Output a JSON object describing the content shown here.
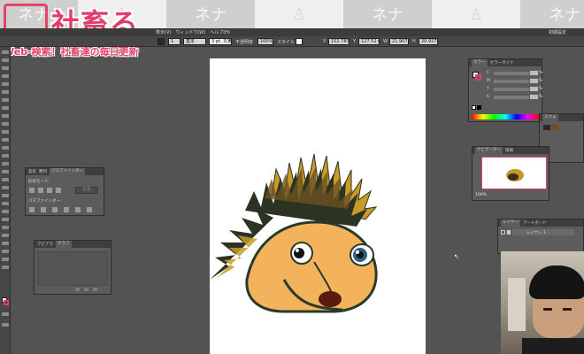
{
  "watermark": {
    "cells": [
      {
        "kind": "dark",
        "glyph": "ネナ"
      },
      {
        "kind": "light",
        "glyph": "♙"
      },
      {
        "kind": "dark",
        "glyph": "ネナ"
      },
      {
        "kind": "light",
        "glyph": "♙"
      },
      {
        "kind": "dark",
        "glyph": "ネナ"
      },
      {
        "kind": "light",
        "glyph": "♙"
      },
      {
        "kind": "dark",
        "glyph": "ネナ"
      }
    ]
  },
  "logo": {
    "title": "社畜る",
    "subtitle": "Web-検索！社畜達の毎日更新"
  },
  "menu": {
    "items": [
      "表示(V)",
      "ウィンドウ(W)",
      "ヘルプ(H)"
    ],
    "right_label": "初期設定"
  },
  "control_bar": {
    "stroke_weight": "1",
    "profile": "基本",
    "brush": "3 pt. 丸筆",
    "opacity_label": "不透明度",
    "opacity": "100%",
    "style_label": "スタイル",
    "x_label": "X",
    "x": "152.783 m",
    "y_label": "Y",
    "y": "127.52 mm",
    "w_label": "W",
    "w": "21.907 m",
    "h_label": "H",
    "h": "20.927 m"
  },
  "colors": {
    "accent": "#e23e6a",
    "ui_bg": "#535353",
    "panel": "#5c5c5c",
    "artboard": "#ffffff",
    "hedgehog_body": "#f2b35c",
    "hedgehog_quills": "#2c3322",
    "hedgehog_outline": "#2a3a2a",
    "hedgehog_nose": "#5a1a0c",
    "hedgehog_eye_iris": "#2e5f86"
  },
  "panels": {
    "color": {
      "tabs": [
        "カラー",
        "カラーガイド"
      ],
      "channels": [
        "C",
        "M",
        "Y",
        "K"
      ],
      "unit": "%"
    },
    "small": {
      "tabs": [
        "スウォ"
      ]
    },
    "navigator": {
      "tabs": [
        "ナビゲーター",
        "情報"
      ],
      "zoom": "100%"
    },
    "pathfinder": {
      "tabs": [
        "変形",
        "整列",
        "パスファインダー"
      ],
      "shape_mode_label": "形状モード：",
      "expand_label": "拡張",
      "pathfinder_label": "パスファインダー："
    },
    "appearance": {
      "tabs": [
        "アピアラ",
        "グラフ"
      ]
    },
    "layers": {
      "tabs": [
        "レイヤー",
        "アートボード"
      ],
      "layer_name": "レイヤー 1"
    }
  }
}
